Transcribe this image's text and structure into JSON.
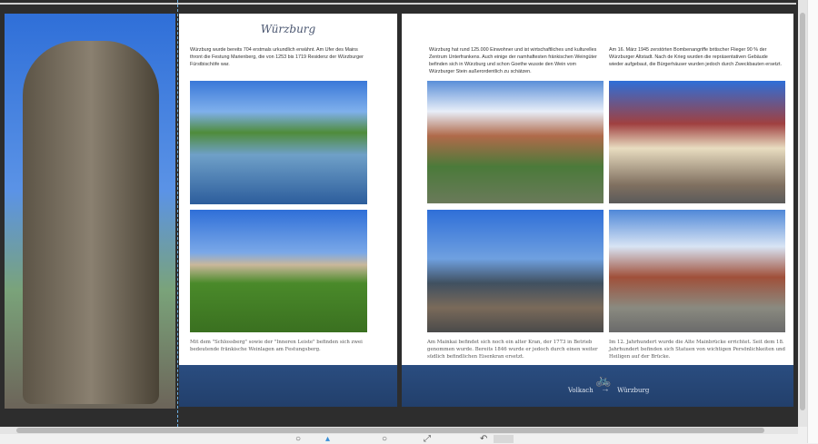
{
  "left_page": {
    "title": "Würzburg",
    "intro": "Würzburg wurde bereits 704 erstmals urkundlich erwähnt. Am Ufer des Mains thront die Festung Marienberg, die von 1253 bis 1719 Residenz der Würzburger Fürstbischöfe war.",
    "caption": "Mit dem \"Schlossberg\" sowie der \"Inneren Leiste\" befinden sich zwei bedeutende fränkische Weinlagen am Festungsberg."
  },
  "right_page": {
    "text_left": "Würzburg hat rund 125.000 Einwohner und ist wirtschaftliches und kulturelles Zentrum Unterfrankens. Auch einige der namhaftesten fränkischen Weingüter befinden sich in Würzburg und schon Goethe wusste den Wein vom Würzburger Stein außerordentlich zu schätzen.",
    "text_right": "Am 16. März 1945 zerstörten Bombenangriffe britischer Flieger 90 % der Würzburger Altstadt. Nach de Krieg wurden die repräsentativen Gebäude wieder aufgebaut, die Bürgerhäuser wurden jedoch durch Zweckbauten ersetzt.",
    "caption_left": "Am Mainkai befindet sich noch ein alter Kran, der 1773 in Betrieb genommen wurde. Bereits 1846 wurde er jedoch durch einen weiter südlich befindlichen Eisenkran ersetzt.",
    "caption_right": "Im 12. Jahrhundert wurde die Alte Mainbrücke errichtet. Seit dem 18. Jahrhundert befinden sich Statuen von wichtigen Persönlichkeiten und Heiligen auf der Brücke.",
    "route_from": "Volkach",
    "route_arrow": "⇢",
    "route_to": "Würzburg"
  },
  "colors": {
    "band": "#2a4d80",
    "canvas": "#2d2d2d",
    "guide": "#6fb3e8"
  },
  "icons": [
    "bicycle-icon",
    "zoom-out-icon",
    "zoom-in-icon",
    "fit-icon",
    "undo-icon"
  ]
}
